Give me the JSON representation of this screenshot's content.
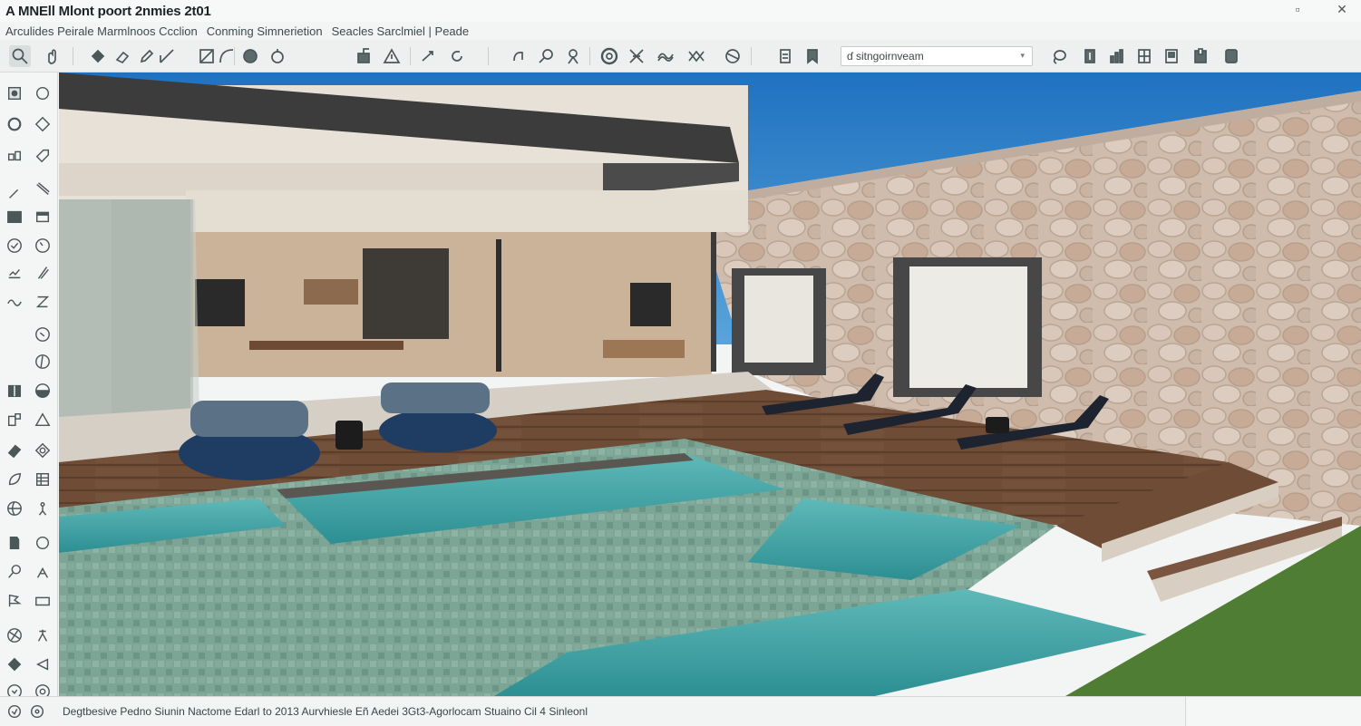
{
  "app": {
    "title": "A MNEll Mlont poort 2nmies 2t01"
  },
  "window": {
    "minimize_label": "▫",
    "close_label": "✕"
  },
  "menu": {
    "items": [
      "Arculides Peirale Marmlnoos Ccclion",
      "Conming Simnerietion",
      "Seacles Sarclmiel | Peade"
    ]
  },
  "search": {
    "value": "ɗ sitngoirnveam",
    "icon": "search-icon"
  },
  "status": {
    "text": "Degtbesive Pedno Siunin Nactome Edarl to 2013 Aurvhiesle Eñ Aedei 3Gt3-Agorlocam Stuaino Cil 4 Sinleonl"
  },
  "scene": {
    "colors": {
      "sky": "#2e7fc4",
      "stone": "#cdb6a3",
      "deck": "#6a4a35",
      "water": "#3fa6a6",
      "tile": "#7fa598",
      "grass": "#4f7d33"
    }
  }
}
